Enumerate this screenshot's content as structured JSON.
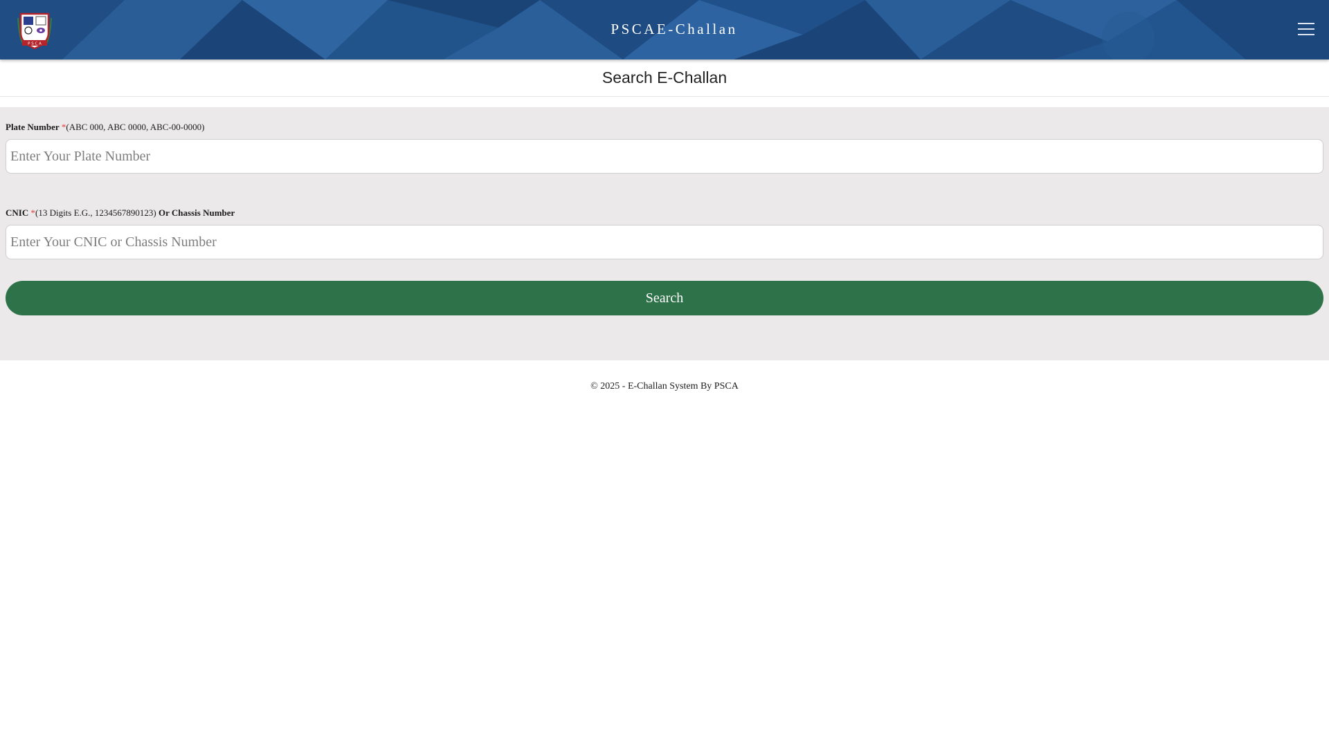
{
  "header": {
    "logo_icon": "psca-crest-logo-icon",
    "title": "PSCAE-Challan",
    "menu_icon": "hamburger-menu-icon",
    "colors": {
      "background": "#1d4a80",
      "text": "#ffffff"
    }
  },
  "page": {
    "title": "Search E-Challan"
  },
  "form": {
    "plate": {
      "label": "Plate Number",
      "required_mark": "*",
      "hint": "(ABC 000, ABC 0000, ABC-00-0000)",
      "placeholder": "Enter Your Plate Number",
      "value": ""
    },
    "cnic": {
      "label": "CNIC",
      "required_mark": "*",
      "hint": "(13 Digits E.G., 1234567890123)",
      "label_suffix": "Or Chassis Number",
      "placeholder": "Enter Your CNIC or Chassis Number",
      "value": ""
    },
    "search_button_label": "Search",
    "colors": {
      "panel": "#ebe9e9",
      "button": "#2e7249",
      "required": "#e53935"
    }
  },
  "footer": {
    "text": "© 2025 - E-Challan System By PSCA"
  }
}
